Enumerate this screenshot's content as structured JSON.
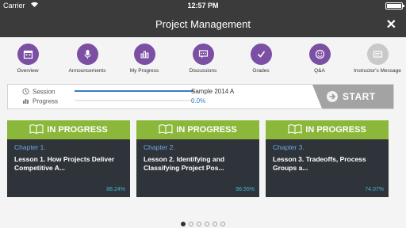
{
  "status_bar": {
    "carrier": "Carrier",
    "time": "12:57 PM"
  },
  "header": {
    "title": "Project Management",
    "close_glyph": "✕"
  },
  "nav": {
    "items": [
      {
        "label": "Overview",
        "icon": "calendar-icon"
      },
      {
        "label": "Announcements",
        "icon": "microphone-icon"
      },
      {
        "label": "My Progress",
        "icon": "bar-chart-icon"
      },
      {
        "label": "Discussions",
        "icon": "chat-bubble-icon"
      },
      {
        "label": "Grades",
        "icon": "checkmark-icon"
      },
      {
        "label": "Q&A",
        "icon": "smiley-icon"
      },
      {
        "label": "Instructor's Message",
        "icon": "message-icon"
      }
    ],
    "accent_color": "#7b4fa3",
    "disabled_color": "#c9c9c9"
  },
  "progress_panel": {
    "session_label": "Session",
    "session_value": "Sample 2014 A",
    "progress_label": "Progress",
    "progress_value": "0.0%",
    "session_fill": 1.0,
    "progress_fill": 0.0,
    "start_label": "START"
  },
  "cards": [
    {
      "status": "IN PROGRESS",
      "chapter": "Chapter 1.",
      "lesson": "Lesson 1. How Projects Deliver Competitive A...",
      "percent": "88.24%"
    },
    {
      "status": "IN PROGRESS",
      "chapter": "Chapter 2.",
      "lesson": "Lesson 2. Identifying and Classifying Project Pos...",
      "percent": "96.55%"
    },
    {
      "status": "IN PROGRESS",
      "chapter": "Chapter 3.",
      "lesson": "Lesson 3. Tradeoffs, Process Groups a...",
      "percent": "74.07%"
    }
  ],
  "colors": {
    "header_bg": "#3b3b3b",
    "card_band": "#8bb83a",
    "card_bg": "#2f343b",
    "chapter_text": "#6fa8e3",
    "percent_text": "#3db9d4"
  },
  "pagination": {
    "total": 6,
    "active": 1
  }
}
